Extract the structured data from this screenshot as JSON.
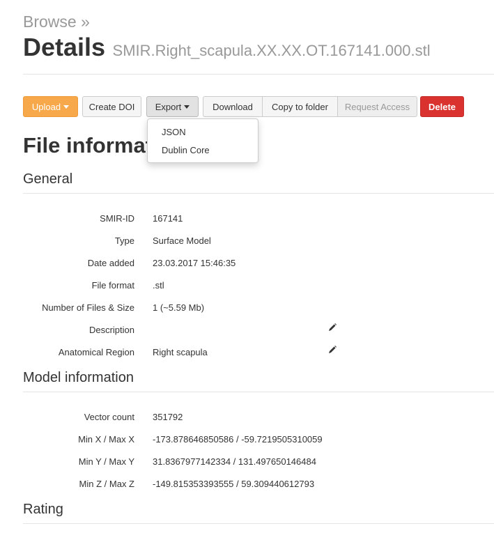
{
  "breadcrumb": "Browse »",
  "title": "Details",
  "filename": "SMIR.Right_scapula.XX.XX.OT.167141.000.stl",
  "toolbar": {
    "upload": "Upload",
    "create_doi": "Create DOI",
    "export": "Export",
    "download": "Download",
    "copy_to_folder": "Copy to folder",
    "request_access": "Request Access",
    "delete": "Delete"
  },
  "export_menu": [
    "JSON",
    "Dublin Core"
  ],
  "file_info_heading": "File informatio",
  "general": {
    "heading": "General",
    "rows": [
      {
        "label": "SMIR-ID",
        "value": "167141"
      },
      {
        "label": "Type",
        "value": "Surface Model"
      },
      {
        "label": "Date added",
        "value": "23.03.2017 15:46:35"
      },
      {
        "label": "File format",
        "value": ".stl"
      },
      {
        "label": "Number of Files & Size",
        "value": "1 (~5.59 Mb)"
      },
      {
        "label": "Description",
        "value": ""
      },
      {
        "label": "Anatomical Region",
        "value": "Right scapula"
      }
    ]
  },
  "model": {
    "heading": "Model information",
    "rows": [
      {
        "label": "Vector count",
        "value": "351792"
      },
      {
        "label": "Min X / Max X",
        "value": "-173.878646850586 / -59.7219505310059"
      },
      {
        "label": "Min Y / Max Y",
        "value": "31.8367977142334 / 131.497650146484"
      },
      {
        "label": "Min Z / Max Z",
        "value": "-149.815353393555 / 59.309440612793"
      }
    ]
  },
  "rating_heading": "Rating",
  "colors": {
    "upload": "#f7a84a",
    "delete": "#d9322f"
  }
}
